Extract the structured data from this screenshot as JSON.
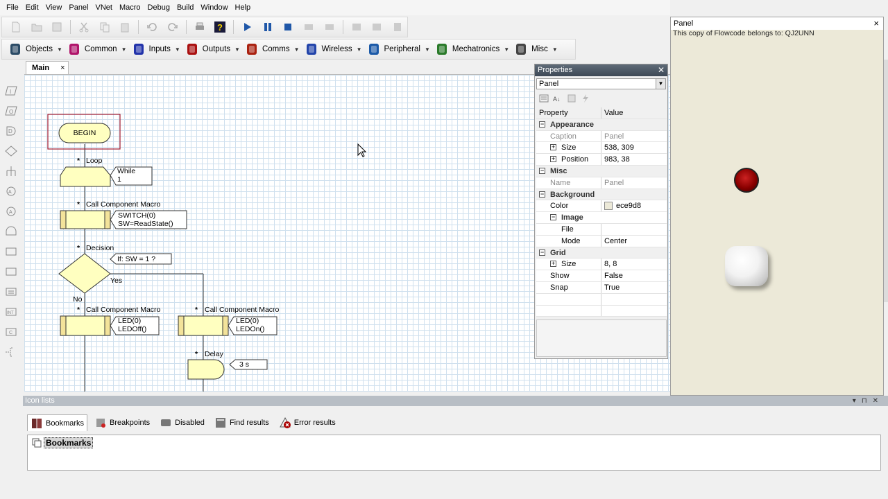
{
  "menu": [
    "File",
    "Edit",
    "View",
    "Panel",
    "VNet",
    "Macro",
    "Debug",
    "Build",
    "Window",
    "Help"
  ],
  "components_toolbar": [
    {
      "label": "Objects",
      "icon": "objects-icon",
      "color": "#2b4b66"
    },
    {
      "label": "Common",
      "icon": "common-icon",
      "color": "#b0156a"
    },
    {
      "label": "Inputs",
      "icon": "inputs-icon",
      "color": "#2233aa"
    },
    {
      "label": "Outputs",
      "icon": "outputs-icon",
      "color": "#aa1111"
    },
    {
      "label": "Comms",
      "icon": "comms-icon",
      "color": "#aa2211"
    },
    {
      "label": "Wireless",
      "icon": "wireless-icon",
      "color": "#2244aa"
    },
    {
      "label": "Peripheral",
      "icon": "peripheral-icon",
      "color": "#1c5aa8"
    },
    {
      "label": "Mechatronics",
      "icon": "mechatronics-icon",
      "color": "#2a7a2a"
    },
    {
      "label": "Misc",
      "icon": "misc-icon",
      "color": "#444444"
    }
  ],
  "document_tab": {
    "label": "Main",
    "close": "×"
  },
  "flowchart": {
    "begin": "BEGIN",
    "loop": {
      "title": "Loop",
      "cond_line1": "While",
      "cond_line2": "1"
    },
    "macro1": {
      "title": "Call Component Macro",
      "line1": "SWITCH(0)",
      "line2": "SW=ReadState()"
    },
    "decision": {
      "title": "Decision",
      "cond": "If: SW = 1 ?",
      "yes": "Yes",
      "no": "No"
    },
    "macro_no": {
      "title": "Call Component Macro",
      "line1": "LED(0)",
      "line2": "LEDOff()"
    },
    "macro_yes": {
      "title": "Call Component Macro",
      "line1": "LED(0)",
      "line2": "LEDOn()"
    },
    "delay": {
      "title": "Delay",
      "value": "3 s"
    },
    "star": "*"
  },
  "properties": {
    "title": "Properties",
    "selected": "Panel",
    "header": {
      "property": "Property",
      "value": "Value"
    },
    "rows": [
      {
        "kind": "cat",
        "name": "Appearance"
      },
      {
        "kind": "dim",
        "name": "Caption",
        "value": "Panel"
      },
      {
        "kind": "exp",
        "name": "Size",
        "value": "538, 309"
      },
      {
        "kind": "exp",
        "name": "Position",
        "value": "983, 38"
      },
      {
        "kind": "cat",
        "name": "Misc"
      },
      {
        "kind": "dim",
        "name": "Name",
        "value": "Panel"
      },
      {
        "kind": "cat",
        "name": "Background"
      },
      {
        "kind": "color",
        "name": "Color",
        "value": "ece9d8"
      },
      {
        "kind": "subcat",
        "name": "Image"
      },
      {
        "kind": "sub",
        "name": "File",
        "value": ""
      },
      {
        "kind": "sub",
        "name": "Mode",
        "value": "Center"
      },
      {
        "kind": "cat",
        "name": "Grid"
      },
      {
        "kind": "exp",
        "name": "Size",
        "value": "8, 8"
      },
      {
        "kind": "plain",
        "name": "Show",
        "value": "False"
      },
      {
        "kind": "plain",
        "name": "Snap",
        "value": "True"
      }
    ]
  },
  "panel_window": {
    "title": "Panel",
    "owner": "This copy of Flowcode belongs to: QJ2UNN",
    "close": "×"
  },
  "icon_lists": {
    "title": "Icon lists",
    "tabs": [
      {
        "label": "Bookmarks",
        "icon": "bookmarks-icon",
        "active": true
      },
      {
        "label": "Breakpoints",
        "icon": "breakpoints-icon",
        "active": false
      },
      {
        "label": "Disabled",
        "icon": "disabled-icon",
        "active": false
      },
      {
        "label": "Find results",
        "icon": "find-results-icon",
        "active": false
      },
      {
        "label": "Error results",
        "icon": "error-results-icon",
        "active": false
      }
    ],
    "content_item": "Bookmarks"
  },
  "colors": {
    "flow_fill": "#ffffc0",
    "begin_border": "#a0192f",
    "led_red": "#8a0000",
    "panel_bg": "#ece9d8"
  }
}
